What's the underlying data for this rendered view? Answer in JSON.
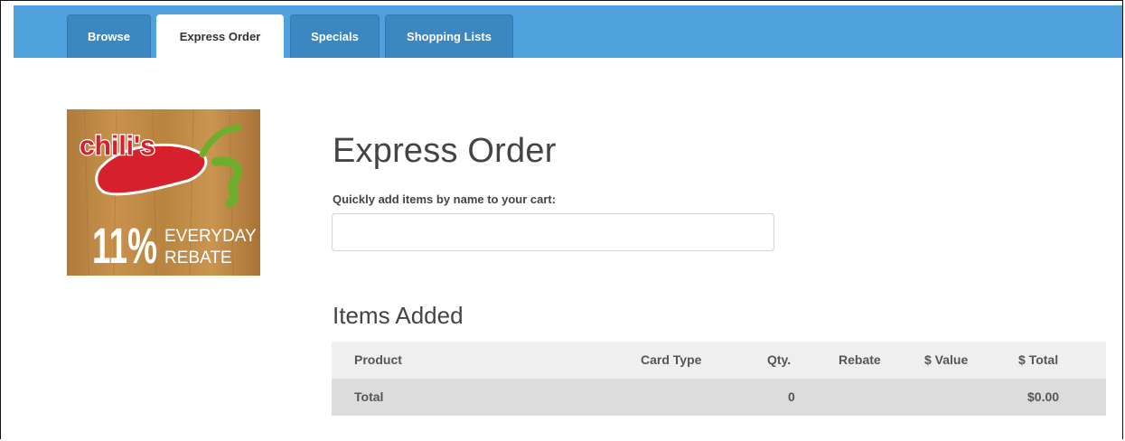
{
  "nav": {
    "tabs": [
      {
        "label": "Browse",
        "active": false
      },
      {
        "label": "Express Order",
        "active": true
      },
      {
        "label": "Specials",
        "active": false
      },
      {
        "label": "Shopping Lists",
        "active": false
      }
    ]
  },
  "promo": {
    "brand": "chili's",
    "rebate_percent": "11%",
    "line1": "EVERYDAY",
    "line2": "REBATE"
  },
  "main": {
    "title": "Express Order",
    "subtitle": "Quickly add items by name to your cart:",
    "search_value": "",
    "search_placeholder": ""
  },
  "items": {
    "title": "Items Added",
    "columns": {
      "product": "Product",
      "card_type": "Card Type",
      "qty": "Qty.",
      "rebate": "Rebate",
      "value": "$ Value",
      "total": "$ Total"
    },
    "total_row": {
      "label": "Total",
      "qty": "0",
      "total": "$0.00"
    }
  },
  "colors": {
    "nav_bg": "#4ea1dc",
    "tab_bg": "#3a87c1",
    "header_row": "#efefef",
    "total_row": "#dcdcdc"
  }
}
